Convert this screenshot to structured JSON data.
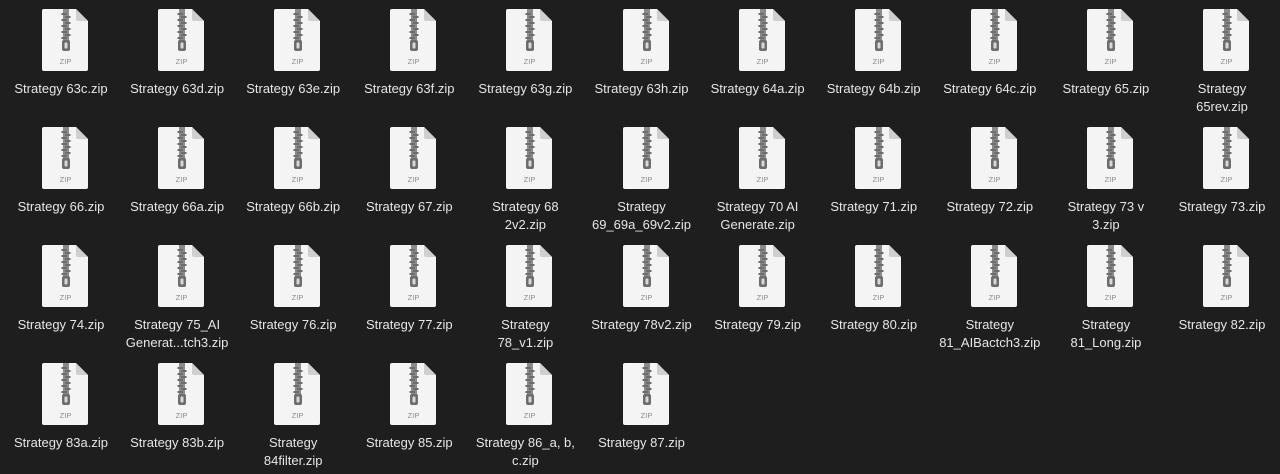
{
  "window": {
    "background": "#1e1e1e",
    "text_color": "#e6e6e6"
  },
  "icon": {
    "name": "zip-archive-icon",
    "type_label": "ZIP",
    "paper_color": "#f4f4f4",
    "zipper_color": "#6d6d6d"
  },
  "files": [
    {
      "name": "Strategy 63c.zip"
    },
    {
      "name": "Strategy 63d.zip"
    },
    {
      "name": "Strategy 63e.zip"
    },
    {
      "name": "Strategy 63f.zip"
    },
    {
      "name": "Strategy 63g.zip"
    },
    {
      "name": "Strategy 63h.zip"
    },
    {
      "name": "Strategy 64a.zip"
    },
    {
      "name": "Strategy 64b.zip"
    },
    {
      "name": "Strategy 64c.zip"
    },
    {
      "name": "Strategy 65.zip"
    },
    {
      "name": "Strategy\n65rev.zip"
    },
    {
      "name": "Strategy 66.zip"
    },
    {
      "name": "Strategy 66a.zip"
    },
    {
      "name": "Strategy 66b.zip"
    },
    {
      "name": "Strategy 67.zip"
    },
    {
      "name": "Strategy 68\n2v2.zip"
    },
    {
      "name": "Strategy\n69_69a_69v2.zip"
    },
    {
      "name": "Strategy 70 AI\nGenerate.zip"
    },
    {
      "name": "Strategy 71.zip"
    },
    {
      "name": "Strategy 72.zip"
    },
    {
      "name": "Strategy 73 v\n3.zip"
    },
    {
      "name": "Strategy 73.zip"
    },
    {
      "name": "Strategy 74.zip"
    },
    {
      "name": "Strategy 75_AI\nGenerat...tch3.zip"
    },
    {
      "name": "Strategy 76.zip"
    },
    {
      "name": "Strategy 77.zip"
    },
    {
      "name": "Strategy\n78_v1.zip"
    },
    {
      "name": "Strategy 78v2.zip"
    },
    {
      "name": "Strategy 79.zip"
    },
    {
      "name": "Strategy 80.zip"
    },
    {
      "name": "Strategy\n81_AIBactch3.zip"
    },
    {
      "name": "Strategy\n81_Long.zip"
    },
    {
      "name": "Strategy 82.zip"
    },
    {
      "name": "Strategy 83a.zip"
    },
    {
      "name": "Strategy 83b.zip"
    },
    {
      "name": "Strategy\n84filter.zip"
    },
    {
      "name": "Strategy 85.zip"
    },
    {
      "name": "Strategy 86_a, b,\nc.zip"
    },
    {
      "name": "Strategy 87.zip"
    }
  ]
}
